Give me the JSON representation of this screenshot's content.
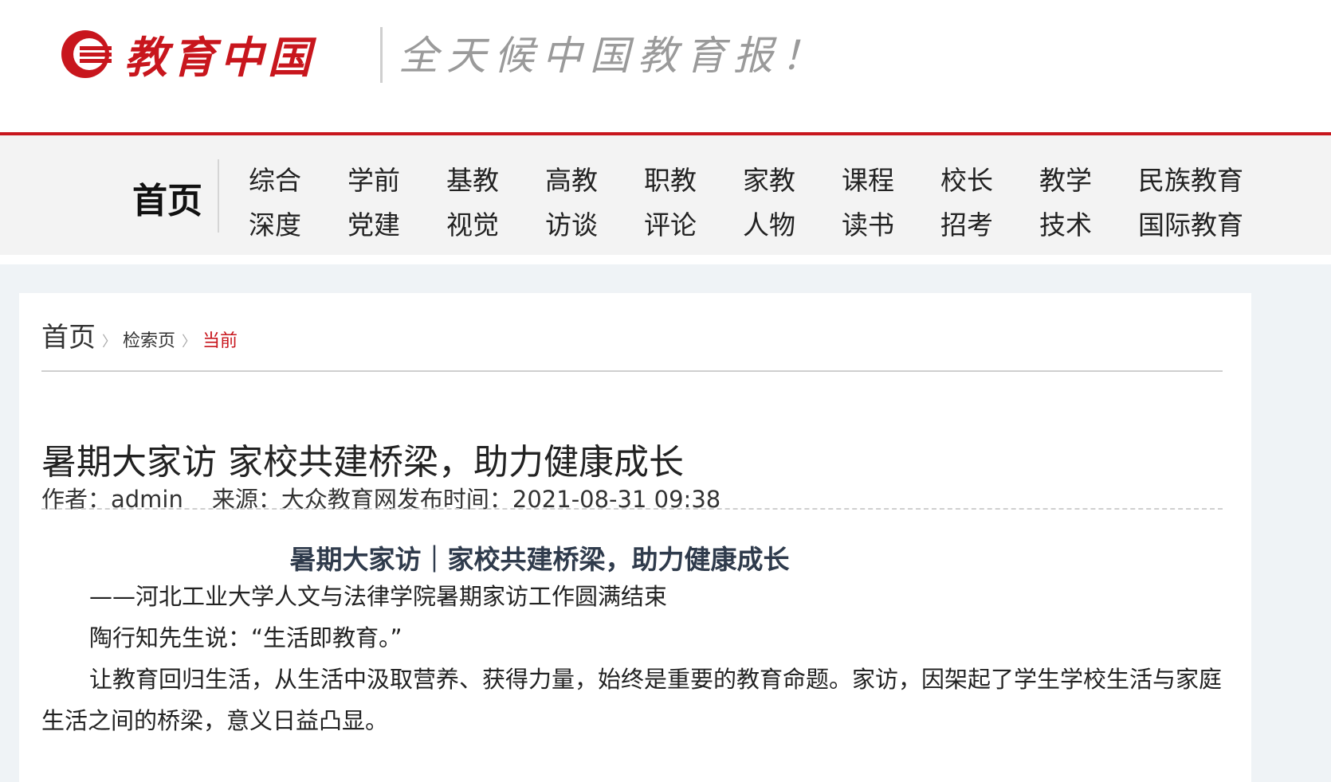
{
  "brand": {
    "logo_text": "教育中国",
    "slogan": "全天候中国教育报！",
    "accent_color": "#c8161d"
  },
  "nav": {
    "home": "首页",
    "row1": [
      "综合",
      "学前",
      "基教",
      "高教",
      "职教",
      "家教",
      "课程",
      "校长",
      "教学",
      "民族教育"
    ],
    "row2": [
      "深度",
      "党建",
      "视觉",
      "访谈",
      "评论",
      "人物",
      "读书",
      "招考",
      "技术",
      "国际教育"
    ]
  },
  "breadcrumb": {
    "home": "首页",
    "search": "检索页",
    "current": "当前"
  },
  "article": {
    "title": "暑期大家访 家校共建桥梁，助力健康成长",
    "author": "作者：admin",
    "source": "来源：大众教育网",
    "published": "发布时间：2021-08-31 09:38",
    "sub_title": "暑期大家访｜家校共建桥梁，助力健康成长",
    "paragraphs": [
      "——河北工业大学人文与法律学院暑期家访工作圆满结束",
      "陶行知先生说：“生活即教育。”",
      "让教育回归生活，从生活中汲取营养、获得力量，始终是重要的教育命题。家访，因架起了学生学校生活与家庭生活之间的桥梁，意义日益凸显。"
    ]
  }
}
